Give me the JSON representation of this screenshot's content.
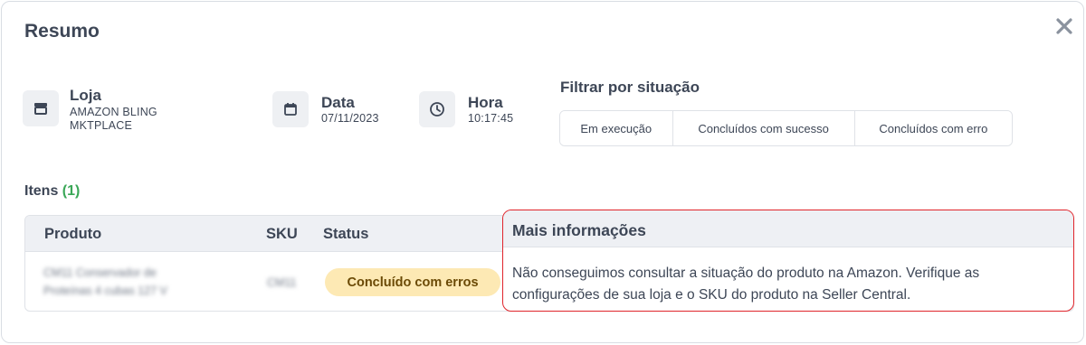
{
  "modal": {
    "title": "Resumo",
    "close_icon": "close-icon"
  },
  "info": {
    "store": {
      "icon": "store-icon",
      "label": "Loja",
      "value_line1": "AMAZON BLING",
      "value_line2": "MKTPLACE"
    },
    "date": {
      "icon": "calendar-icon",
      "label": "Data",
      "value": "07/11/2023"
    },
    "time": {
      "icon": "clock-icon",
      "label": "Hora",
      "value": "10:17:45"
    }
  },
  "filter": {
    "title": "Filtrar por situação",
    "options": [
      "Em execução",
      "Concluídos com sucesso",
      "Concluídos com erro"
    ]
  },
  "items": {
    "label": "Itens",
    "count": "(1)"
  },
  "table": {
    "headers": {
      "product": "Produto",
      "sku": "SKU",
      "status": "Status"
    },
    "rows": [
      {
        "product_line1": "CM11 Conservador de",
        "product_line2": "Proteínas 4 cubas 127 V",
        "sku": "CM11",
        "status": "Concluído com erros"
      }
    ]
  },
  "popover": {
    "title": "Mais informações",
    "text": "Não conseguimos consultar a situação do produto na Amazon. Verifique as configurações de sua loja e o SKU do produto na Seller Central."
  },
  "colors": {
    "text": "#3d4656",
    "count_green": "#3aa757",
    "badge_bg": "#fde9b4",
    "highlight_red": "#e0242b",
    "header_bg": "#eef0f4"
  }
}
